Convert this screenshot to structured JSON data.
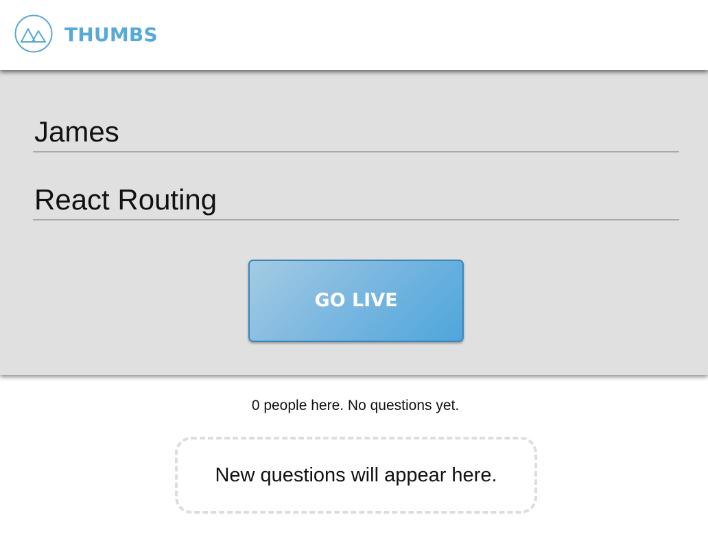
{
  "header": {
    "brand": "THUMBS",
    "logo_icon": "triangles-circle-icon",
    "accent_color": "#56a9d8"
  },
  "form": {
    "name_value": "James",
    "topic_value": "React Routing",
    "go_live_label": "GO LIVE",
    "button_color": "#4ea6dc"
  },
  "status": {
    "text": "0 people here. No questions yet."
  },
  "questions": {
    "empty_text": "New questions will appear here."
  }
}
